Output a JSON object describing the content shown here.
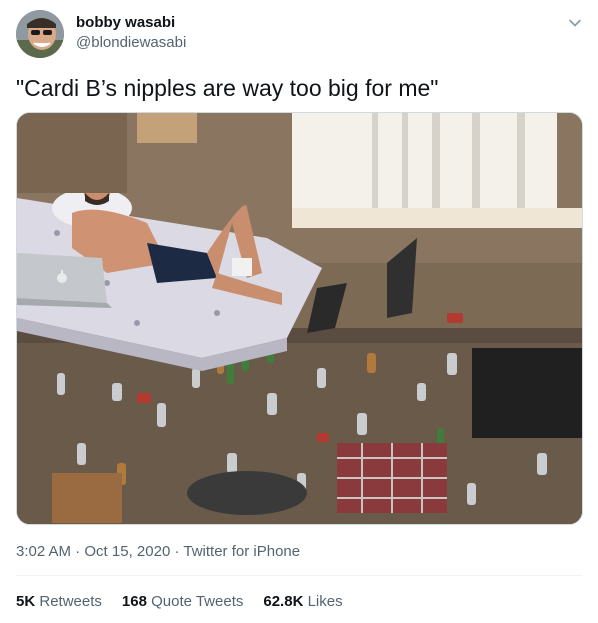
{
  "author": {
    "name": "bobby wasabi",
    "handle": "@blondiewasabi"
  },
  "tweet": {
    "text": "\"Cardi B’s nipples are way too big for me\""
  },
  "meta": {
    "time": "3:02 AM",
    "separator": "·",
    "date": "Oct 15, 2020",
    "source": "Twitter for iPhone"
  },
  "stats": {
    "retweets_count": "5K",
    "retweets_label": "Retweets",
    "quotes_count": "168",
    "quotes_label": "Quote Tweets",
    "likes_count": "62.8K",
    "likes_label": "Likes"
  },
  "icons": {
    "more": "chevron-down-icon",
    "laptop_logo": "apple-logo-icon"
  },
  "colors": {
    "text_primary": "#0f1419",
    "text_secondary": "#536471",
    "divider": "#eff3f4"
  }
}
